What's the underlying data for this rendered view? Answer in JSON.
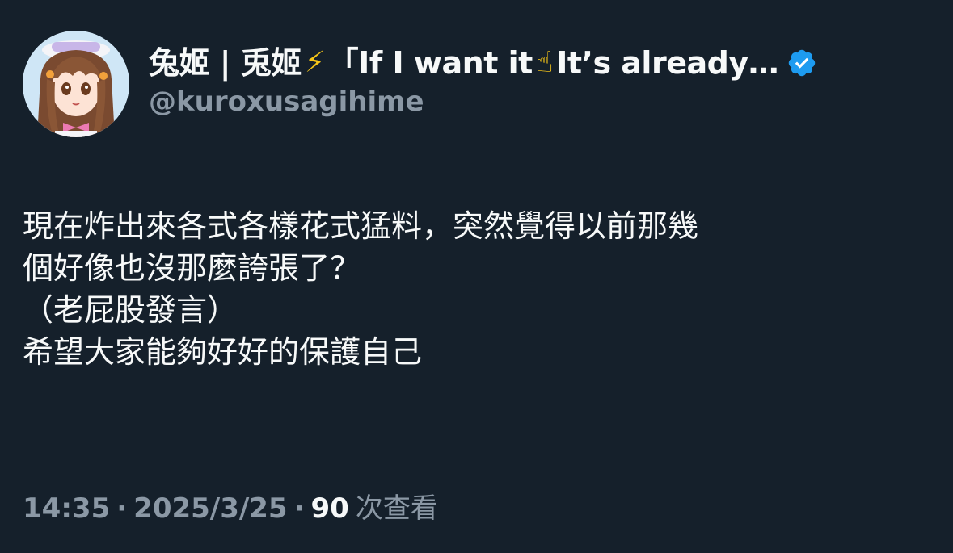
{
  "tweet": {
    "author": {
      "display_name_prefix": "兔姬 | 兎姬",
      "display_name_emoji_1": "⚡",
      "display_name_mid": "「If I want it",
      "display_name_emoji_2": "☝",
      "display_name_suffix": "It’s already…",
      "handle": "@kuroxusagihime",
      "verified": true
    },
    "text": "現在炸出來各式各樣花式猛料，突然覺得以前那幾\n個好像也沒那麼誇張了？\n（老屁股發言）\n希望大家能夠好好的保護自己",
    "time": "14:35",
    "date": "2025/3/25",
    "separator": "·",
    "views_count": "90",
    "views_label": "次查看"
  },
  "colors": {
    "background": "#15202b",
    "text": "#f7f9f9",
    "secondary": "#8b98a5",
    "verified": "#1d9bf0"
  },
  "icons": {
    "verified": "verified-badge-icon",
    "avatar": "anime-girl-avatar"
  }
}
